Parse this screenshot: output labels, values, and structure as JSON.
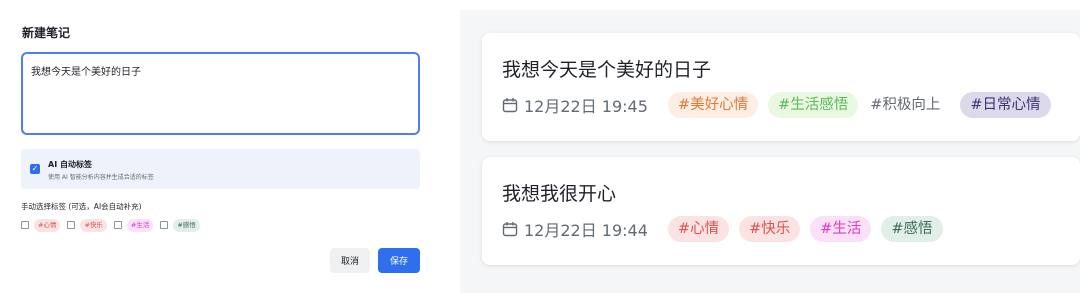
{
  "form": {
    "title": "新建笔记",
    "input_value": "我想今天是个美好的日子",
    "ai": {
      "title": "AI 自动标签",
      "description": "使用 AI 智能分析内容并生成合适的标签",
      "checked": true
    },
    "manual_label": "手动选择标签 (可选，AI会自动补充)",
    "tag_options": [
      {
        "label": "#心情",
        "bg": "#fbe3e4",
        "color": "#d9534f"
      },
      {
        "label": "#快乐",
        "bg": "#fbe3e4",
        "color": "#d9534f"
      },
      {
        "label": "#生活",
        "bg": "#fbe0f7",
        "color": "#d63dc8"
      },
      {
        "label": "#感悟",
        "bg": "#e2efe9",
        "color": "#3d6b5a"
      }
    ],
    "cancel_label": "取消",
    "save_label": "保存"
  },
  "notes": [
    {
      "title": "我想今天是个美好的日子",
      "date": "12月22日 19:45",
      "tags": [
        {
          "label": "#美好心情",
          "bg": "#fdeee4",
          "color": "#e07a3a"
        },
        {
          "label": "#生活感悟",
          "bg": "#e9f9e1",
          "color": "#5cb85c"
        },
        {
          "label": "#积极向上",
          "bg": "#ffffff",
          "color": "#646a73"
        },
        {
          "label": "#日常心情",
          "bg": "#dcd9ea",
          "color": "#3c3475"
        }
      ]
    },
    {
      "title": "我想我很开心",
      "date": "12月22日 19:44",
      "tags": [
        {
          "label": "#心情",
          "bg": "#fbe3e4",
          "color": "#d9534f"
        },
        {
          "label": "#快乐",
          "bg": "#fbe3e4",
          "color": "#d9534f"
        },
        {
          "label": "#生活",
          "bg": "#fbe0f7",
          "color": "#d63dc8"
        },
        {
          "label": "#感悟",
          "bg": "#e2efe9",
          "color": "#3d6b5a"
        }
      ]
    }
  ],
  "icons": {
    "date": "calendar-icon",
    "check": "checkmark-icon"
  }
}
